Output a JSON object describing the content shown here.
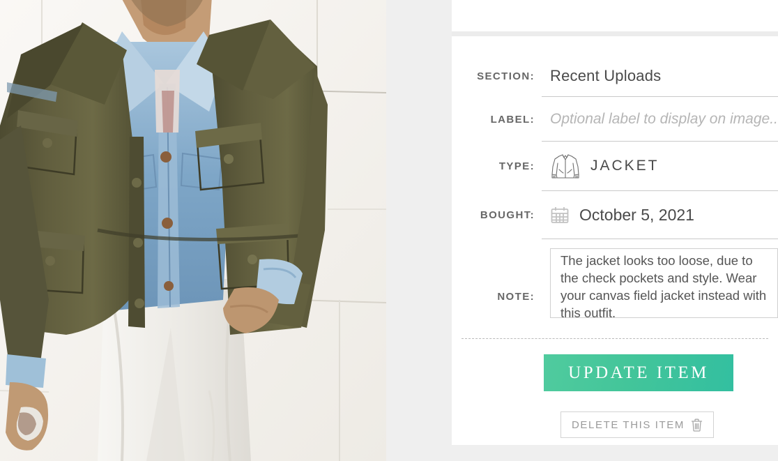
{
  "photo": {
    "alt_description": "Man wearing olive green military field jacket over light blue denim shirt and white jeans, standing against a white concrete wall",
    "colors": {
      "wall": "#f4f2ee",
      "jacket_olive": "#5e5c3c",
      "jacket_olive_dark": "#44432a",
      "jacket_olive_light": "#75724c",
      "denim": "#7ba3c4",
      "denim_light": "#a8c4da",
      "denim_dark": "#5b82a6",
      "skin": "#c09a74",
      "skin_shadow": "#a07a55",
      "pants_white": "#f6f5f2",
      "pants_shadow": "#e2e0dc",
      "belt_brown": "#7a4a2c",
      "hair": "#3a2a1e"
    }
  },
  "panel": {
    "fields": {
      "section": {
        "label": "Section:",
        "value": "Recent Uploads"
      },
      "label": {
        "label": "Label:",
        "value": "",
        "placeholder": "Optional label to display on image..."
      },
      "type": {
        "label": "Type:",
        "icon": "jacket-icon",
        "value": "Jacket"
      },
      "bought": {
        "label": "Bought:",
        "icon": "calendar-icon",
        "value": "October 5, 2021"
      },
      "note": {
        "label": "Note:",
        "value": "The jacket looks too loose, due to the check pockets and style. Wear your canvas field jacket instead with this outfit."
      }
    },
    "actions": {
      "update_label": "Update Item",
      "delete_label": "Delete This Item",
      "delete_icon": "trash-icon"
    },
    "colors": {
      "update_button_start": "#50cb9e",
      "update_button_end": "#33bfa0",
      "label_text": "#676767",
      "value_text": "#4a4a4a",
      "placeholder_text": "#b5b5b5",
      "delete_text": "#9a9a9a",
      "rule": "#c9c9c9"
    }
  }
}
